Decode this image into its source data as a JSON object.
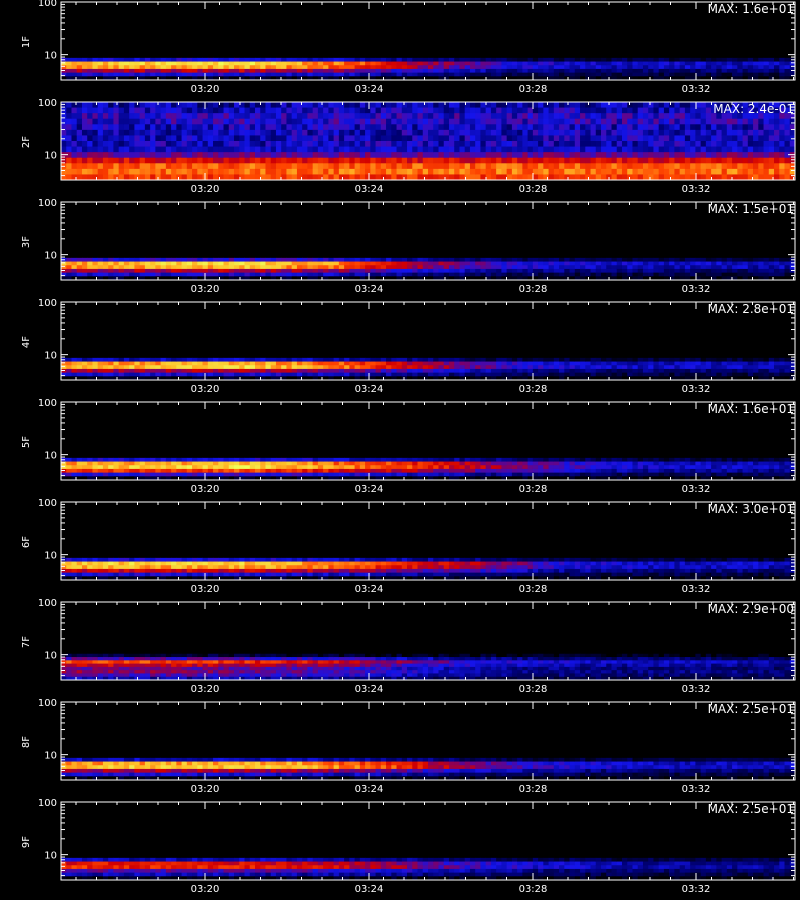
{
  "chart_data": [
    {
      "type": "heatmap",
      "ylabel": "1F",
      "max_label": "MAX: 1.6e+01",
      "yticks": [
        "100",
        "10"
      ],
      "xticks": [
        "03:20",
        "03:24",
        "03:28",
        "03:32"
      ],
      "yscale": "log",
      "colormap": "black-blue-red-yellow",
      "profile": [
        0.0,
        0.0,
        0.35,
        0.95,
        0.9,
        0.6,
        0.35,
        0.05
      ],
      "intensity_over_time": [
        [
          0,
          0.92
        ],
        [
          0.25,
          0.98
        ],
        [
          0.4,
          0.82
        ],
        [
          0.48,
          0.6
        ],
        [
          0.6,
          0.4
        ],
        [
          0.75,
          0.32
        ],
        [
          1,
          0.3
        ]
      ]
    },
    {
      "type": "heatmap",
      "ylabel": "2F",
      "max_label": "MAX: 2.4e-01",
      "yticks": [
        "100",
        "10"
      ],
      "xticks": [
        "03:20",
        "03:24",
        "03:28",
        "03:32"
      ],
      "yscale": "log",
      "colormap": "black-blue-red-yellow",
      "profile": [
        0.25,
        0.3,
        0.35,
        0.35,
        0.3,
        0.3,
        0.3,
        0.3,
        0.35,
        0.55,
        0.75,
        0.9,
        0.92,
        0.85
      ],
      "intensity_over_time": [
        [
          0,
          0.85
        ],
        [
          1,
          0.85
        ]
      ]
    },
    {
      "type": "heatmap",
      "ylabel": "3F",
      "max_label": "MAX: 1.5e+01",
      "yticks": [
        "100",
        "10"
      ],
      "xticks": [
        "03:20",
        "03:24",
        "03:28",
        "03:32"
      ],
      "yscale": "log",
      "colormap": "black-blue-red-yellow",
      "profile": [
        0.0,
        0.0,
        0.4,
        0.95,
        0.9,
        0.6,
        0.35,
        0.05
      ],
      "intensity_over_time": [
        [
          0,
          0.9
        ],
        [
          0.25,
          0.98
        ],
        [
          0.38,
          0.85
        ],
        [
          0.48,
          0.62
        ],
        [
          0.6,
          0.4
        ],
        [
          0.75,
          0.32
        ],
        [
          1,
          0.3
        ]
      ]
    },
    {
      "type": "heatmap",
      "ylabel": "4F",
      "max_label": "MAX: 2.8e+01",
      "yticks": [
        "100",
        "10"
      ],
      "xticks": [
        "03:20",
        "03:24",
        "03:28",
        "03:32"
      ],
      "yscale": "log",
      "colormap": "black-blue-red-yellow",
      "profile": [
        0.0,
        0.0,
        0.3,
        0.9,
        0.95,
        0.6,
        0.35,
        0.05
      ],
      "intensity_over_time": [
        [
          0,
          0.9
        ],
        [
          0.25,
          0.97
        ],
        [
          0.42,
          0.78
        ],
        [
          0.5,
          0.6
        ],
        [
          0.62,
          0.4
        ],
        [
          0.75,
          0.32
        ],
        [
          1,
          0.3
        ]
      ]
    },
    {
      "type": "heatmap",
      "ylabel": "5F",
      "max_label": "MAX: 1.6e+01",
      "yticks": [
        "100",
        "10"
      ],
      "xticks": [
        "03:20",
        "03:24",
        "03:28",
        "03:32"
      ],
      "yscale": "log",
      "colormap": "black-blue-red-yellow",
      "profile": [
        0.0,
        0.0,
        0.35,
        0.9,
        0.95,
        0.75,
        0.4,
        0.05
      ],
      "intensity_over_time": [
        [
          0,
          0.92
        ],
        [
          0.25,
          0.98
        ],
        [
          0.45,
          0.8
        ],
        [
          0.58,
          0.6
        ],
        [
          0.7,
          0.42
        ],
        [
          0.8,
          0.33
        ],
        [
          1,
          0.3
        ]
      ]
    },
    {
      "type": "heatmap",
      "ylabel": "6F",
      "max_label": "MAX: 3.0e+01",
      "yticks": [
        "100",
        "10"
      ],
      "xticks": [
        "03:20",
        "03:24",
        "03:28",
        "03:32"
      ],
      "yscale": "log",
      "colormap": "black-blue-red-yellow",
      "profile": [
        0.0,
        0.0,
        0.35,
        0.95,
        0.9,
        0.65,
        0.35,
        0.05
      ],
      "intensity_over_time": [
        [
          0,
          0.95
        ],
        [
          0.3,
          0.95
        ],
        [
          0.43,
          0.78
        ],
        [
          0.6,
          0.55
        ],
        [
          0.68,
          0.4
        ],
        [
          0.8,
          0.33
        ],
        [
          1,
          0.3
        ]
      ]
    },
    {
      "type": "heatmap",
      "ylabel": "7F",
      "max_label": "MAX: 2.9e+00",
      "yticks": [
        "100",
        "10"
      ],
      "xticks": [
        "03:20",
        "03:24",
        "03:28",
        "03:32"
      ],
      "yscale": "log",
      "colormap": "black-blue-red-yellow",
      "profile": [
        0.0,
        0.1,
        0.5,
        0.85,
        0.7,
        0.55,
        0.6,
        0.5,
        0.3
      ],
      "intensity_over_time": [
        [
          0,
          0.88
        ],
        [
          0.2,
          0.85
        ],
        [
          0.4,
          0.72
        ],
        [
          0.5,
          0.55
        ],
        [
          0.6,
          0.42
        ],
        [
          0.75,
          0.36
        ],
        [
          1,
          0.33
        ]
      ]
    },
    {
      "type": "heatmap",
      "ylabel": "8F",
      "max_label": "MAX: 2.5e+01",
      "yticks": [
        "100",
        "10"
      ],
      "xticks": [
        "03:20",
        "03:24",
        "03:28",
        "03:32"
      ],
      "yscale": "log",
      "colormap": "black-blue-red-yellow",
      "profile": [
        0.0,
        0.0,
        0.3,
        0.9,
        0.95,
        0.6,
        0.35,
        0.05
      ],
      "intensity_over_time": [
        [
          0,
          0.93
        ],
        [
          0.3,
          0.95
        ],
        [
          0.45,
          0.78
        ],
        [
          0.55,
          0.55
        ],
        [
          0.65,
          0.4
        ],
        [
          0.8,
          0.32
        ],
        [
          1,
          0.3
        ]
      ]
    },
    {
      "type": "heatmap",
      "ylabel": "9F",
      "max_label": "MAX: 2.5e+01",
      "yticks": [
        "100",
        "10"
      ],
      "xticks": [
        "03:20",
        "03:24",
        "03:28",
        "03:32"
      ],
      "yscale": "log",
      "colormap": "black-blue-red-yellow",
      "profile": [
        0.0,
        0.0,
        0.35,
        0.8,
        0.85,
        0.55,
        0.35,
        0.05
      ],
      "intensity_over_time": [
        [
          0,
          0.82
        ],
        [
          0.3,
          0.78
        ],
        [
          0.45,
          0.66
        ],
        [
          0.55,
          0.48
        ],
        [
          0.65,
          0.38
        ],
        [
          0.8,
          0.32
        ],
        [
          1,
          0.3
        ]
      ]
    }
  ]
}
